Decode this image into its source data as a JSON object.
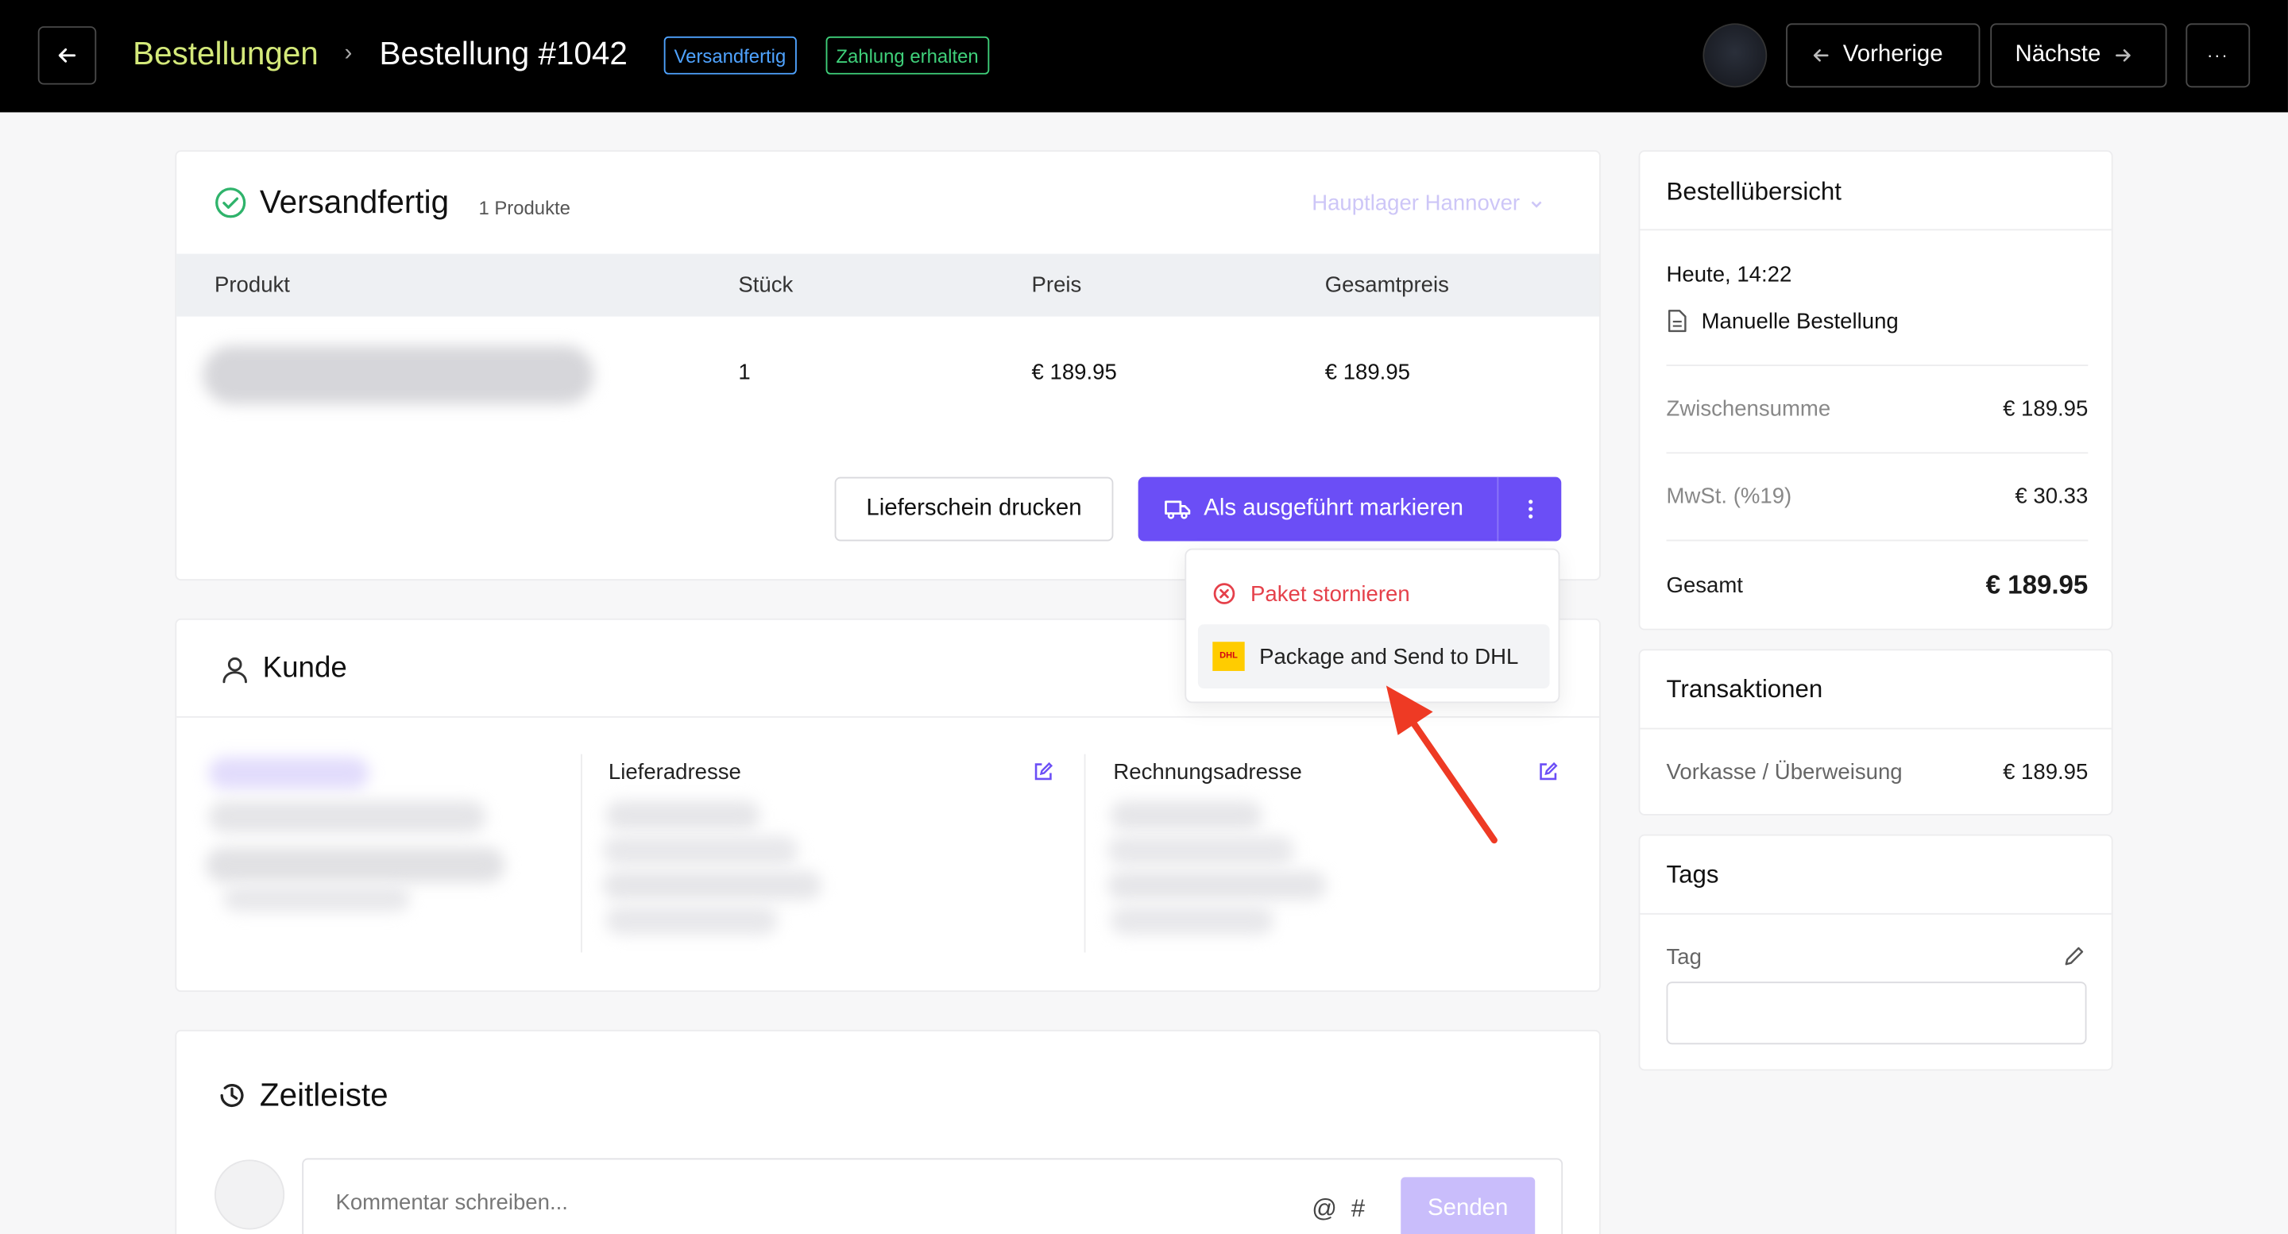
{
  "header": {
    "breadcrumb_parent": "Bestellungen",
    "breadcrumb_current": "Bestellung #1042",
    "badges": [
      "Versandfertig",
      "Zahlung erhalten"
    ],
    "prev_label": "Vorherige",
    "next_label": "Nächste",
    "more_label": "···"
  },
  "shipment": {
    "title": "Versandfertig",
    "count": "1 Produkte",
    "warehouse": "Hauptlager Hannover",
    "columns": [
      "Produkt",
      "Stück",
      "Preis",
      "Gesamtpreis"
    ],
    "row": {
      "qty": "1",
      "price": "€ 189.95",
      "total": "€ 189.95"
    },
    "print_label": "Lieferschein drucken",
    "complete_label": "Als ausgeführt markieren",
    "dropdown": {
      "cancel_label": "Paket stornieren",
      "dhl_label": "Package and Send to DHL",
      "dhl_logo_text": "DHL"
    }
  },
  "customer": {
    "title": "Kunde",
    "shipping_title": "Lieferadresse",
    "billing_title": "Rechnungsadresse"
  },
  "timeline": {
    "title": "Zeitleiste",
    "comment_placeholder": "Kommentar schreiben...",
    "at_symbol": "@",
    "hash_symbol": "#",
    "send_label": "Senden"
  },
  "summary": {
    "title": "Bestellübersicht",
    "date": "Heute, 14:22",
    "source": "Manuelle Bestellung",
    "subtotal_label": "Zwischensumme",
    "subtotal_value": "€ 189.95",
    "tax_label": "MwSt. (%19)",
    "tax_value": "€ 30.33",
    "total_label": "Gesamt",
    "total_value": "€ 189.95"
  },
  "transactions": {
    "title": "Transaktionen",
    "method": "Vorkasse / Überweisung",
    "amount": "€ 189.95"
  },
  "tags": {
    "title": "Tags",
    "label": "Tag"
  },
  "colors": {
    "accent": "#6b4ef6",
    "breadcrumb": "#d4e97a",
    "badge_blue": "#4fa3ff",
    "badge_green": "#3fd07a",
    "danger": "#e5404a",
    "annotation_arrow": "#ee3a24"
  }
}
